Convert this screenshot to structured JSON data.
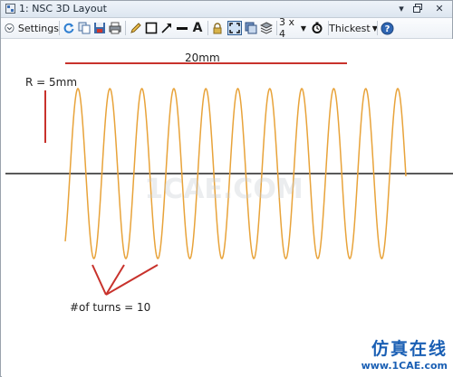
{
  "window": {
    "title": "1: NSC 3D Layout"
  },
  "toolbar": {
    "settings_label": "Settings",
    "grid_label": "3 x 4",
    "thickness_label": "Thickest",
    "icons": [
      "refresh-icon",
      "copy-icon",
      "save-icon",
      "print-icon",
      "pencil-icon",
      "rectangle-icon",
      "arrow-icon",
      "line-icon",
      "text-icon",
      "lock-icon",
      "fit-icon",
      "overlay-icon",
      "layers-icon",
      "timer-icon",
      "help-icon"
    ]
  },
  "annotations": {
    "length_label": "20mm",
    "radius_label": "R = 5mm",
    "turns_label": "#of turns = 10"
  },
  "watermark": {
    "center_text": "1CAE.COM",
    "brand_cn": "仿真在线",
    "brand_url": "www.1CAE.com"
  },
  "colors": {
    "coil": "#e8a33a",
    "annotation": "#c8322c",
    "axis": "#222222",
    "brand_blue": "#1a5fb4"
  }
}
